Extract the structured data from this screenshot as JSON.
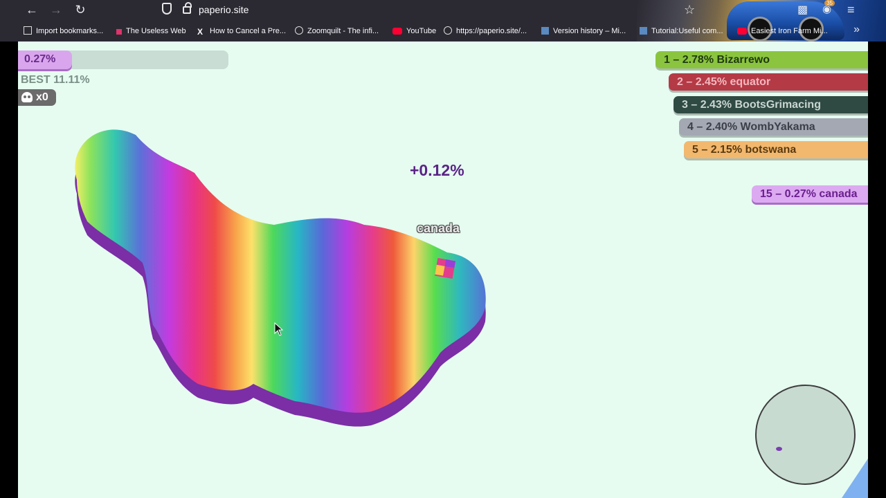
{
  "browser": {
    "url": "paperio.site",
    "extensions_badge": "35",
    "bookmarks": [
      "Import bookmarks...",
      "The Useless Web",
      "How to Cancel a Pre...",
      "Zoomquilt - The infi...",
      "YouTube",
      "https://paperio.site/...",
      "Version history – Mi...",
      "Tutorial:Useful com...",
      "Easiest Iron Farm Mi..."
    ]
  },
  "game": {
    "territory_percent": "0.27%",
    "territory_fraction": 0.0027,
    "best": "BEST 11.11%",
    "kills": "x0",
    "gain_popup": "+0.12%",
    "player_name": "canada",
    "leaderboard": [
      {
        "text": "1 – 2.78% Bizarrewo",
        "color": "#8bc43f",
        "text_color": "#1e3a10"
      },
      {
        "text": "2 – 2.45% equator",
        "color": "#b43a46",
        "text_color": "#f5b8be"
      },
      {
        "text": "3 – 2.43% BootsGrimacing",
        "color": "#2f4a43",
        "text_color": "#c9d6d1"
      },
      {
        "text": "4 – 2.40% WombYakama",
        "color": "#a3a8b3",
        "text_color": "#3b3f48"
      },
      {
        "text": "5 – 2.15% botswana",
        "color": "#f2b86e",
        "text_color": "#5a3a10"
      }
    ],
    "self_rank": {
      "text": "15 – 0.27% canada",
      "color": "#dcaaf0",
      "text_color": "#6a1f8f"
    },
    "colors": {
      "background": "#e6fcf1",
      "player": "#b05ad8"
    }
  }
}
